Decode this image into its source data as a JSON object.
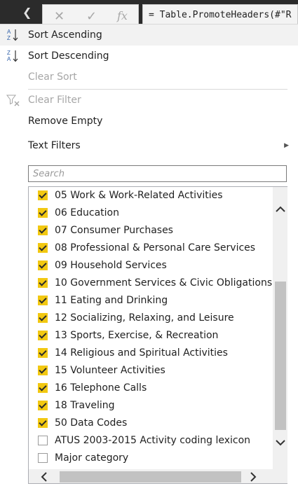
{
  "formula_bar": {
    "cancel_icon": "close-icon",
    "confirm_icon": "check-icon",
    "fx_label": "fx",
    "formula_text": "= Table.PromoteHeaders(#\"R"
  },
  "menu": {
    "sort_ascending": "Sort Ascending",
    "sort_descending": "Sort Descending",
    "clear_sort": "Clear Sort",
    "clear_filter": "Clear Filter",
    "remove_empty": "Remove Empty",
    "text_filters": "Text Filters"
  },
  "search": {
    "placeholder": "Search",
    "value": ""
  },
  "filter_items": [
    {
      "label": "05 Work & Work-Related Activities",
      "checked": true
    },
    {
      "label": "06 Education",
      "checked": true
    },
    {
      "label": "07 Consumer Purchases",
      "checked": true
    },
    {
      "label": "08 Professional & Personal Care Services",
      "checked": true
    },
    {
      "label": "09 Household Services",
      "checked": true
    },
    {
      "label": "10 Government Services & Civic Obligations",
      "checked": true
    },
    {
      "label": "11 Eating and Drinking",
      "checked": true
    },
    {
      "label": "12 Socializing, Relaxing, and Leisure",
      "checked": true
    },
    {
      "label": "13 Sports, Exercise, & Recreation",
      "checked": true
    },
    {
      "label": "14 Religious and Spiritual Activities",
      "checked": true
    },
    {
      "label": "15 Volunteer Activities",
      "checked": true
    },
    {
      "label": "16 Telephone Calls",
      "checked": true
    },
    {
      "label": "18 Traveling",
      "checked": true
    },
    {
      "label": "50 Data Codes",
      "checked": true
    },
    {
      "label": "ATUS 2003-2015 Activity coding lexicon",
      "checked": false
    },
    {
      "label": "Major category",
      "checked": false
    }
  ],
  "colors": {
    "checkbox_checked": "#f2c811",
    "hover_background": "#f2f2f2",
    "disabled_text": "#a6a6a6",
    "sort_icon_blue": "#2e5fa8"
  }
}
